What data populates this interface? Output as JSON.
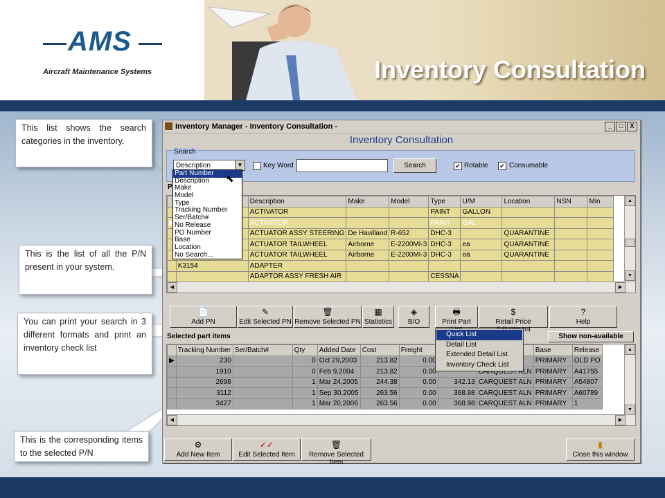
{
  "header": {
    "logo_word": "AMS",
    "logo_subtitle": "Aircraft Maintenance Systems",
    "slide_title": "Inventory Consultation"
  },
  "callouts": [
    "This list shows the search categories in the inventory.",
    "This is the list of all the P/N present in your system.",
    "You can print your search in 3 different formats and print an inventory check list",
    "This is the corresponding items to the selected P/N"
  ],
  "window": {
    "title": "Inventory Manager - Inventory Consultation -",
    "heading": "Inventory Consultation",
    "controls": [
      "_",
      "□",
      "X"
    ],
    "search": {
      "legend": "Search",
      "combo_value": "Description",
      "keyword_label": "Key Word",
      "keyword_checked": false,
      "keyword_value": "",
      "search_button": "Search",
      "rotable_label": "Rotable",
      "rotable_checked": true,
      "consumable_label": "Consumable",
      "consumable_checked": true
    },
    "dropdown_options": [
      "Part Number",
      "Description",
      "Make",
      "Model",
      "Type",
      "Tracking Number",
      "Ser/Batch#",
      "No Release",
      "PO Number",
      "Base",
      "Location",
      "No Search..."
    ],
    "dropdown_selected": "Part Number",
    "parts_caption": "P",
    "parts_columns": [
      "",
      "Description",
      "Make",
      "Model",
      "Type",
      "U/M",
      "Location",
      "NSN",
      "Min"
    ],
    "parts_rows": [
      [
        "",
        "ACTIVATOR",
        "",
        "",
        "PAINT",
        "GALLON",
        "",
        "",
        ""
      ],
      [
        "",
        "ACTIVATOR",
        "",
        "",
        "PAINT",
        "GAL",
        "",
        "",
        ""
      ],
      [
        "",
        "ACTUATOR ASSY STEERING",
        "De Havilland",
        "R-652",
        "DHC-3",
        "",
        "QUARANTINE",
        "",
        ""
      ],
      [
        "",
        "ACTUATOR TAILWHEEL",
        "Airborne",
        "E-2200MI-3",
        "DHC-3",
        "ea",
        "QUARANTINE",
        "",
        ""
      ],
      [
        "",
        "ACTUATOR TAILWHEEL",
        "Airborne",
        "E-2200MI-3",
        "DHC-3",
        "ea",
        "QUARANTINE",
        "",
        ""
      ],
      [
        "K3154",
        "ADAPTER",
        "",
        "",
        "",
        "",
        "",
        "",
        ""
      ],
      [
        "",
        "ADAPTOR ASSY FRESH AIR",
        "",
        "",
        "CESSNA",
        "",
        "",
        "",
        ""
      ]
    ],
    "toolbar": [
      "Add PN",
      "Edit Selected PN",
      "Remove Selected PN",
      "Statistics",
      "B/O",
      "Print Part List",
      "Retail Price Adjustment",
      "Help"
    ],
    "print_menu": [
      "Quick List",
      "Detail List",
      "Extended Detail List",
      "Inventory Check List"
    ],
    "print_menu_selected": "Quick List",
    "selected_caption": "Selected part items",
    "show_nonavailable": "Show non-available",
    "items_columns": [
      "Tracking Number",
      "Ser/Batch#",
      "Qty",
      "Added Date",
      "Cost",
      "Freight",
      "",
      "Supplier",
      "Base",
      "Release"
    ],
    "items_rows": [
      [
        "230",
        "",
        "0",
        "Oct 29,2003",
        "213.82",
        "0.00",
        "",
        "",
        "PRIMARY",
        "OLD PO"
      ],
      [
        "1910",
        "",
        "0",
        "Feb 9,2004",
        "213.82",
        "0.00",
        "",
        "CARQUEST ALN",
        "PRIMARY",
        "A41755"
      ],
      [
        "2698",
        "",
        "1",
        "Mar 24,2005",
        "244.38",
        "0.00",
        "342.13",
        "CARQUEST ALN",
        "PRIMARY",
        "A54807"
      ],
      [
        "3112",
        "",
        "1",
        "Sep 30,2005",
        "263.56",
        "0.00",
        "368.98",
        "CARQUEST ALN",
        "PRIMARY",
        "A60789"
      ],
      [
        "3427",
        "",
        "1",
        "Mar 20,2006",
        "263.56",
        "0.00",
        "368.98",
        "CARQUEST ALN",
        "PRIMARY",
        "1"
      ]
    ],
    "bottom_buttons": [
      "Add New Item",
      "Edit Selected Item",
      "Remove Selected Item"
    ],
    "close_button": "Close this window"
  }
}
